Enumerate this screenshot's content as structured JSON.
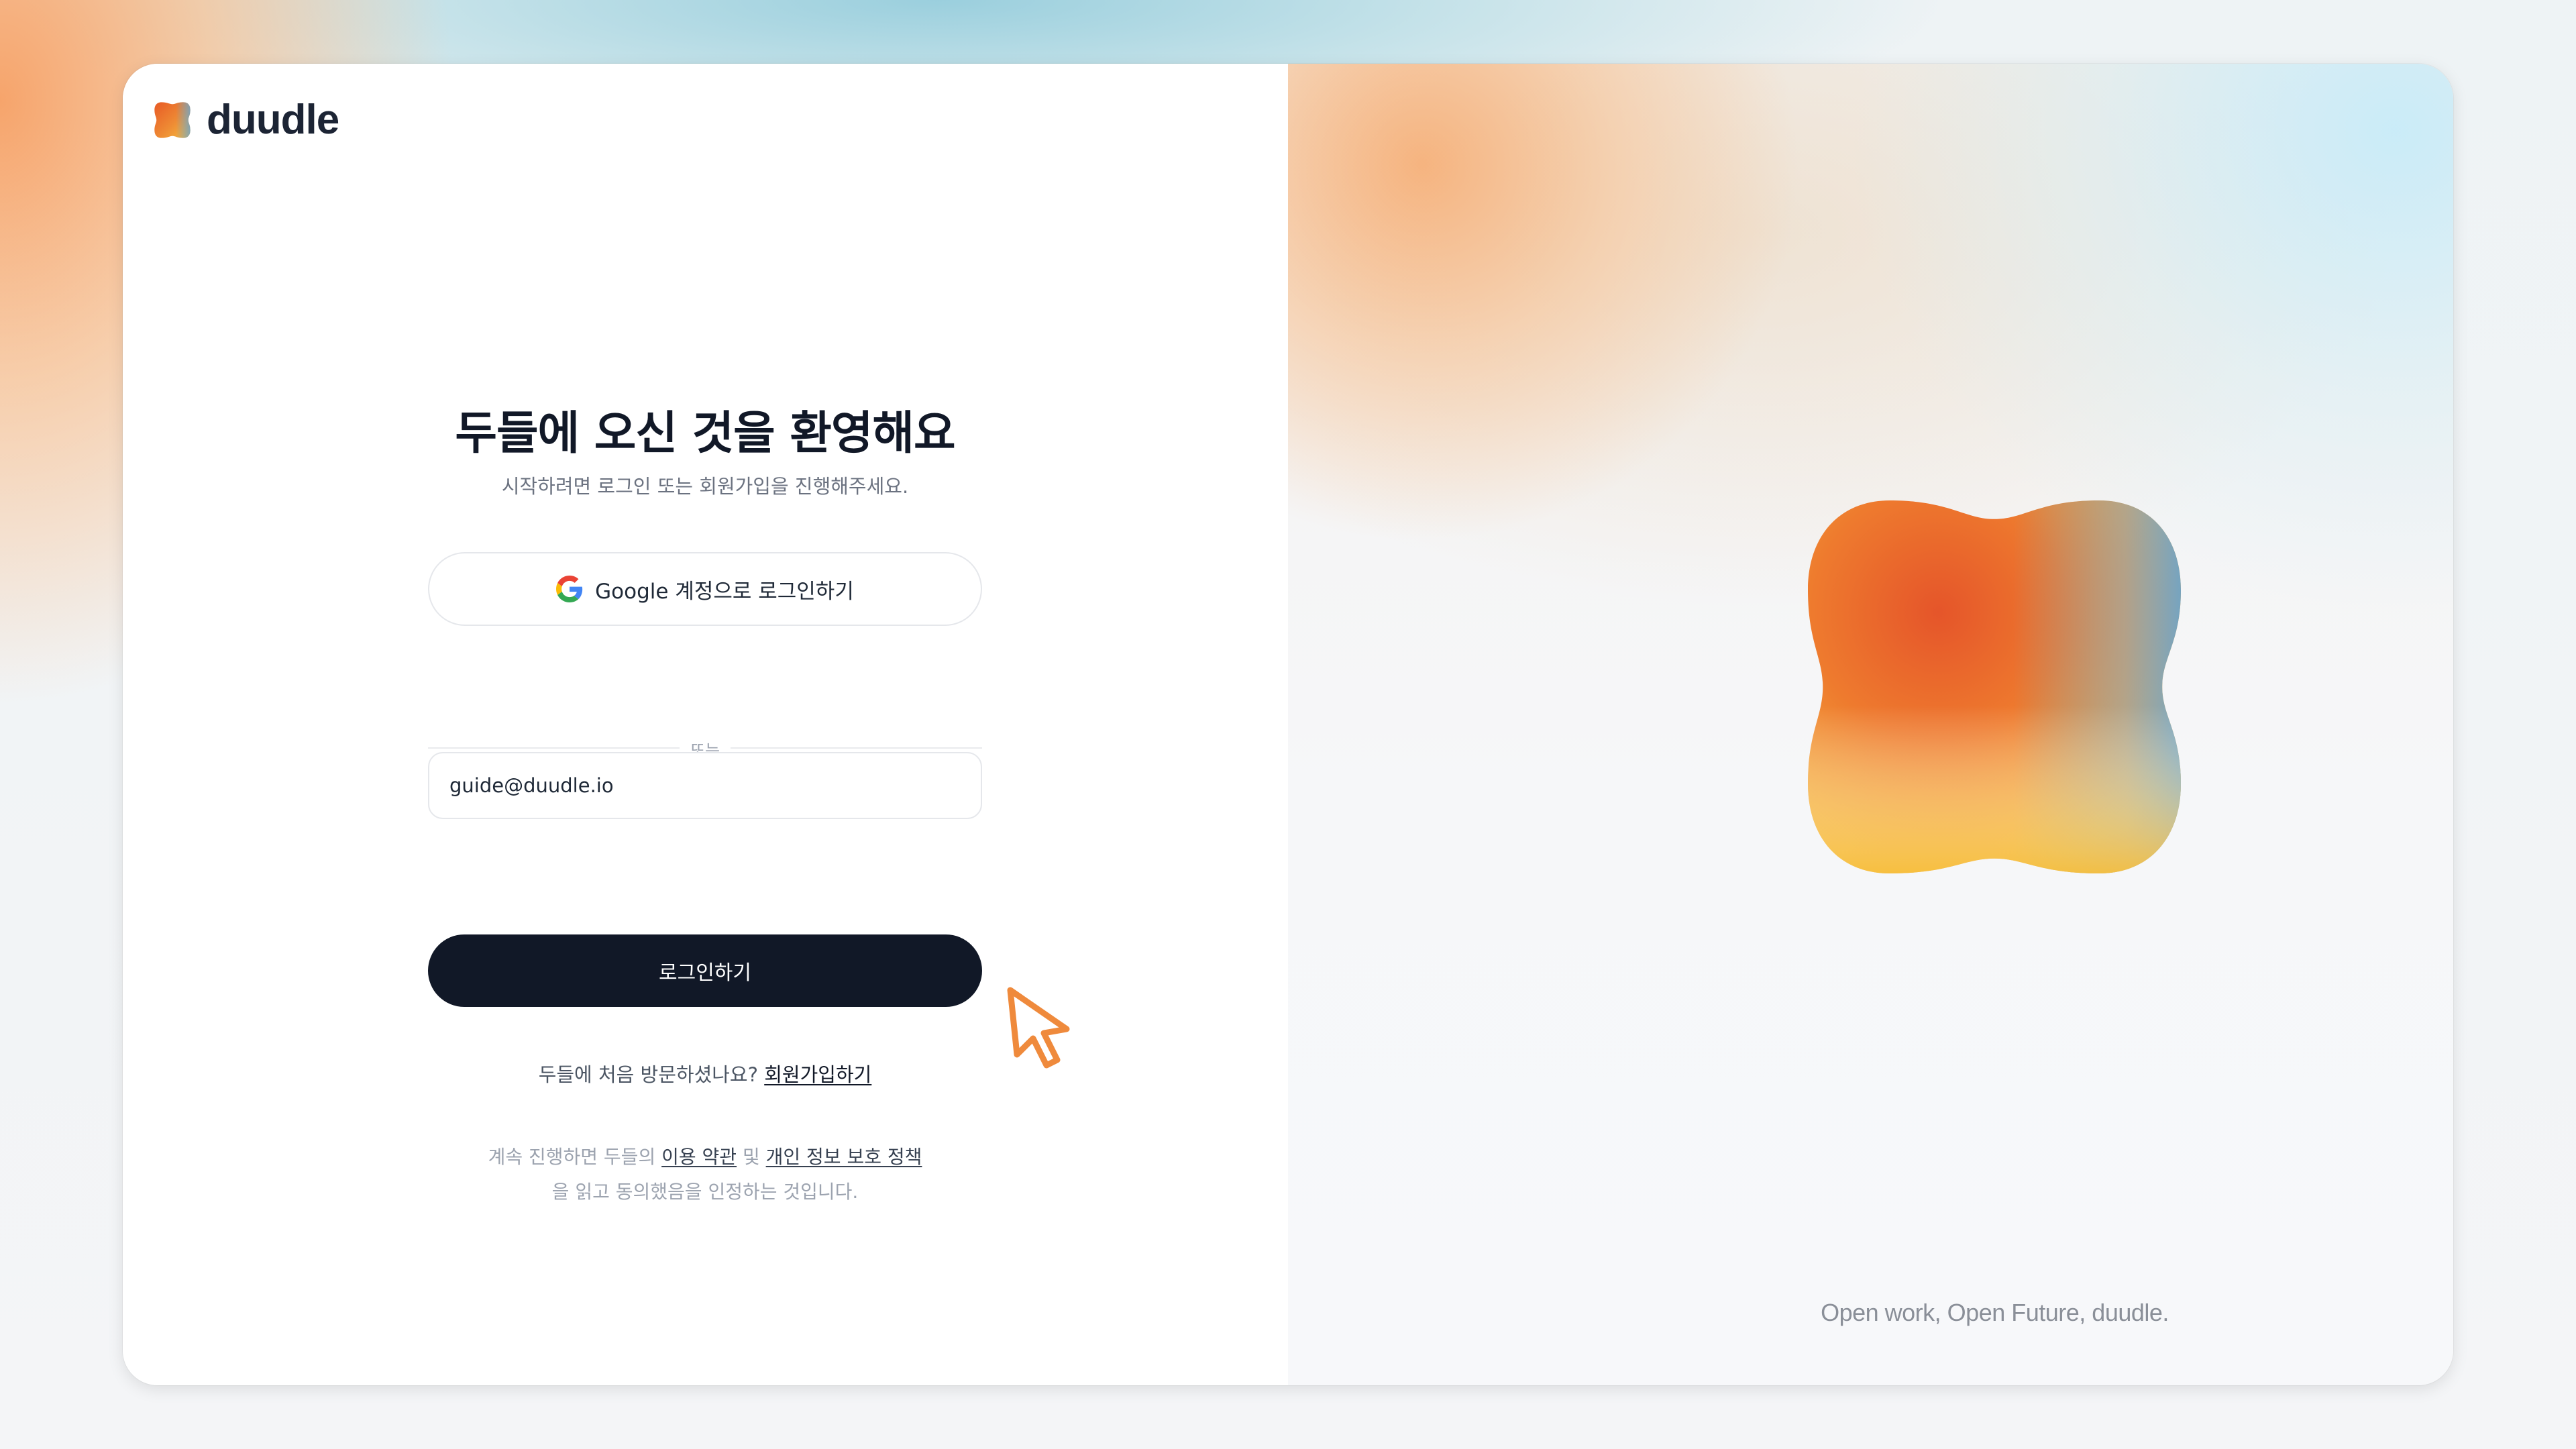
{
  "brand": {
    "name": "duudle"
  },
  "login": {
    "title": "두들에 오신 것을 환영해요",
    "subtitle": "시작하려면 로그인 또는 회원가입을 진행해주세요.",
    "google_button": "Google 계정으로 로그인하기",
    "divider": "또는",
    "email_value": "guide@duudle.io",
    "submit": "로그인하기",
    "signup_prompt": "두들에 처음 방문하셨나요?",
    "signup_link": "회원가입하기",
    "terms_prefix": "계속 진행하면 두들의 ",
    "terms_link": "이용 약관",
    "terms_mid": " 및 ",
    "privacy_link_a": "개인 정보 보호 정책",
    "terms_suffix": "을 읽고 동의했음을 인정하는 것입니다."
  },
  "hero": {
    "tagline": "Open work, Open Future, duudle."
  },
  "colors": {
    "primary": "#111827",
    "accent_orange": "#E85A25",
    "accent_yellow": "#F5B63A",
    "accent_blue": "#6FA3C7"
  },
  "icons": [
    "duudle-logo-icon",
    "google-icon",
    "pointer-cursor-icon"
  ]
}
